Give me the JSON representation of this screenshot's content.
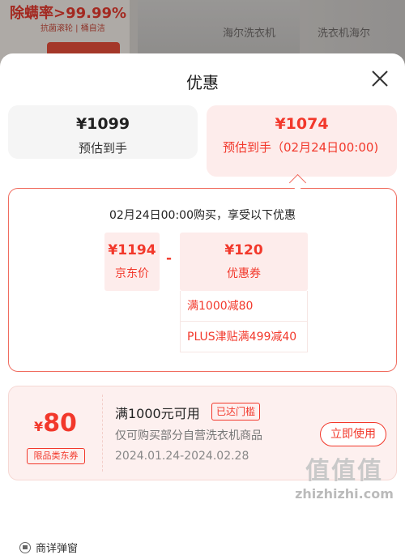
{
  "background": {
    "promo_text": "除螨率>99.99%",
    "promo_sub": "抗菌滚轮 | 桶自洁",
    "product_titles": [
      "海尔洗衣机",
      "洗衣机海尔"
    ]
  },
  "sheet": {
    "title": "优惠"
  },
  "price_tabs": [
    {
      "amount": "¥1099",
      "label": "预估到手"
    },
    {
      "amount": "¥1074",
      "label": "预估到手（02月24日00:00)"
    }
  ],
  "detail": {
    "title": "02月24日00:00购买，享受以下优惠",
    "jd_price": {
      "value": "¥1194",
      "label": "京东价"
    },
    "operator": "-",
    "coupon_total": {
      "value": "¥120",
      "label": "优惠券"
    },
    "coupon_items": [
      "满1000减80",
      "PLUS津贴满499减40"
    ]
  },
  "coupon": {
    "currency": "¥",
    "value": "80",
    "tag": "限品类东券",
    "name": "满1000元可用",
    "status": "已达门槛",
    "desc": "仅可购买部分自营洗衣机商品",
    "date": "2024.01.24-2024.02.28",
    "button": "立即使用"
  },
  "footer": {
    "label": "商详弹窗"
  },
  "watermark": {
    "logo": "值值值",
    "text": "zhizhizhi.com"
  },
  "colors": {
    "accent": "#f2382b",
    "accent_bg": "#fdeceb"
  }
}
